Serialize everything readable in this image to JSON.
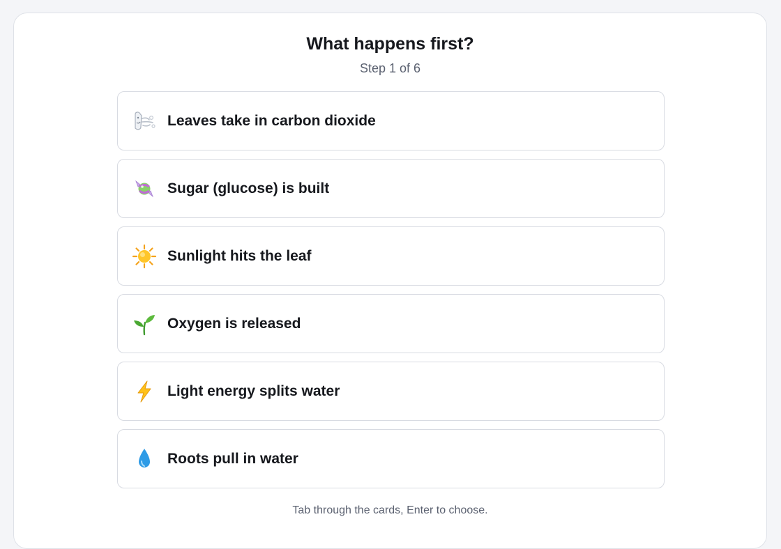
{
  "question": {
    "title_prefix": "What happens ",
    "title_emphasis": "first?",
    "step_label": "Step 1 of 6"
  },
  "cards": [
    {
      "icon": "wind-face-icon",
      "label": "Leaves take in carbon dioxide"
    },
    {
      "icon": "candy-icon",
      "label": "Sugar (glucose) is built"
    },
    {
      "icon": "sun-icon",
      "label": "Sunlight hits the leaf"
    },
    {
      "icon": "seedling-icon",
      "label": "Oxygen is released"
    },
    {
      "icon": "lightning-bolt-icon",
      "label": "Light energy splits water"
    },
    {
      "icon": "water-droplet-icon",
      "label": "Roots pull in water"
    }
  ],
  "hint": "Tab through the cards, Enter to choose.",
  "colors": {
    "page_background": "#f4f5f8",
    "panel_background": "#ffffff",
    "card_border": "#d8dbe2",
    "text_primary": "#16181d",
    "text_secondary": "#5b6170"
  }
}
